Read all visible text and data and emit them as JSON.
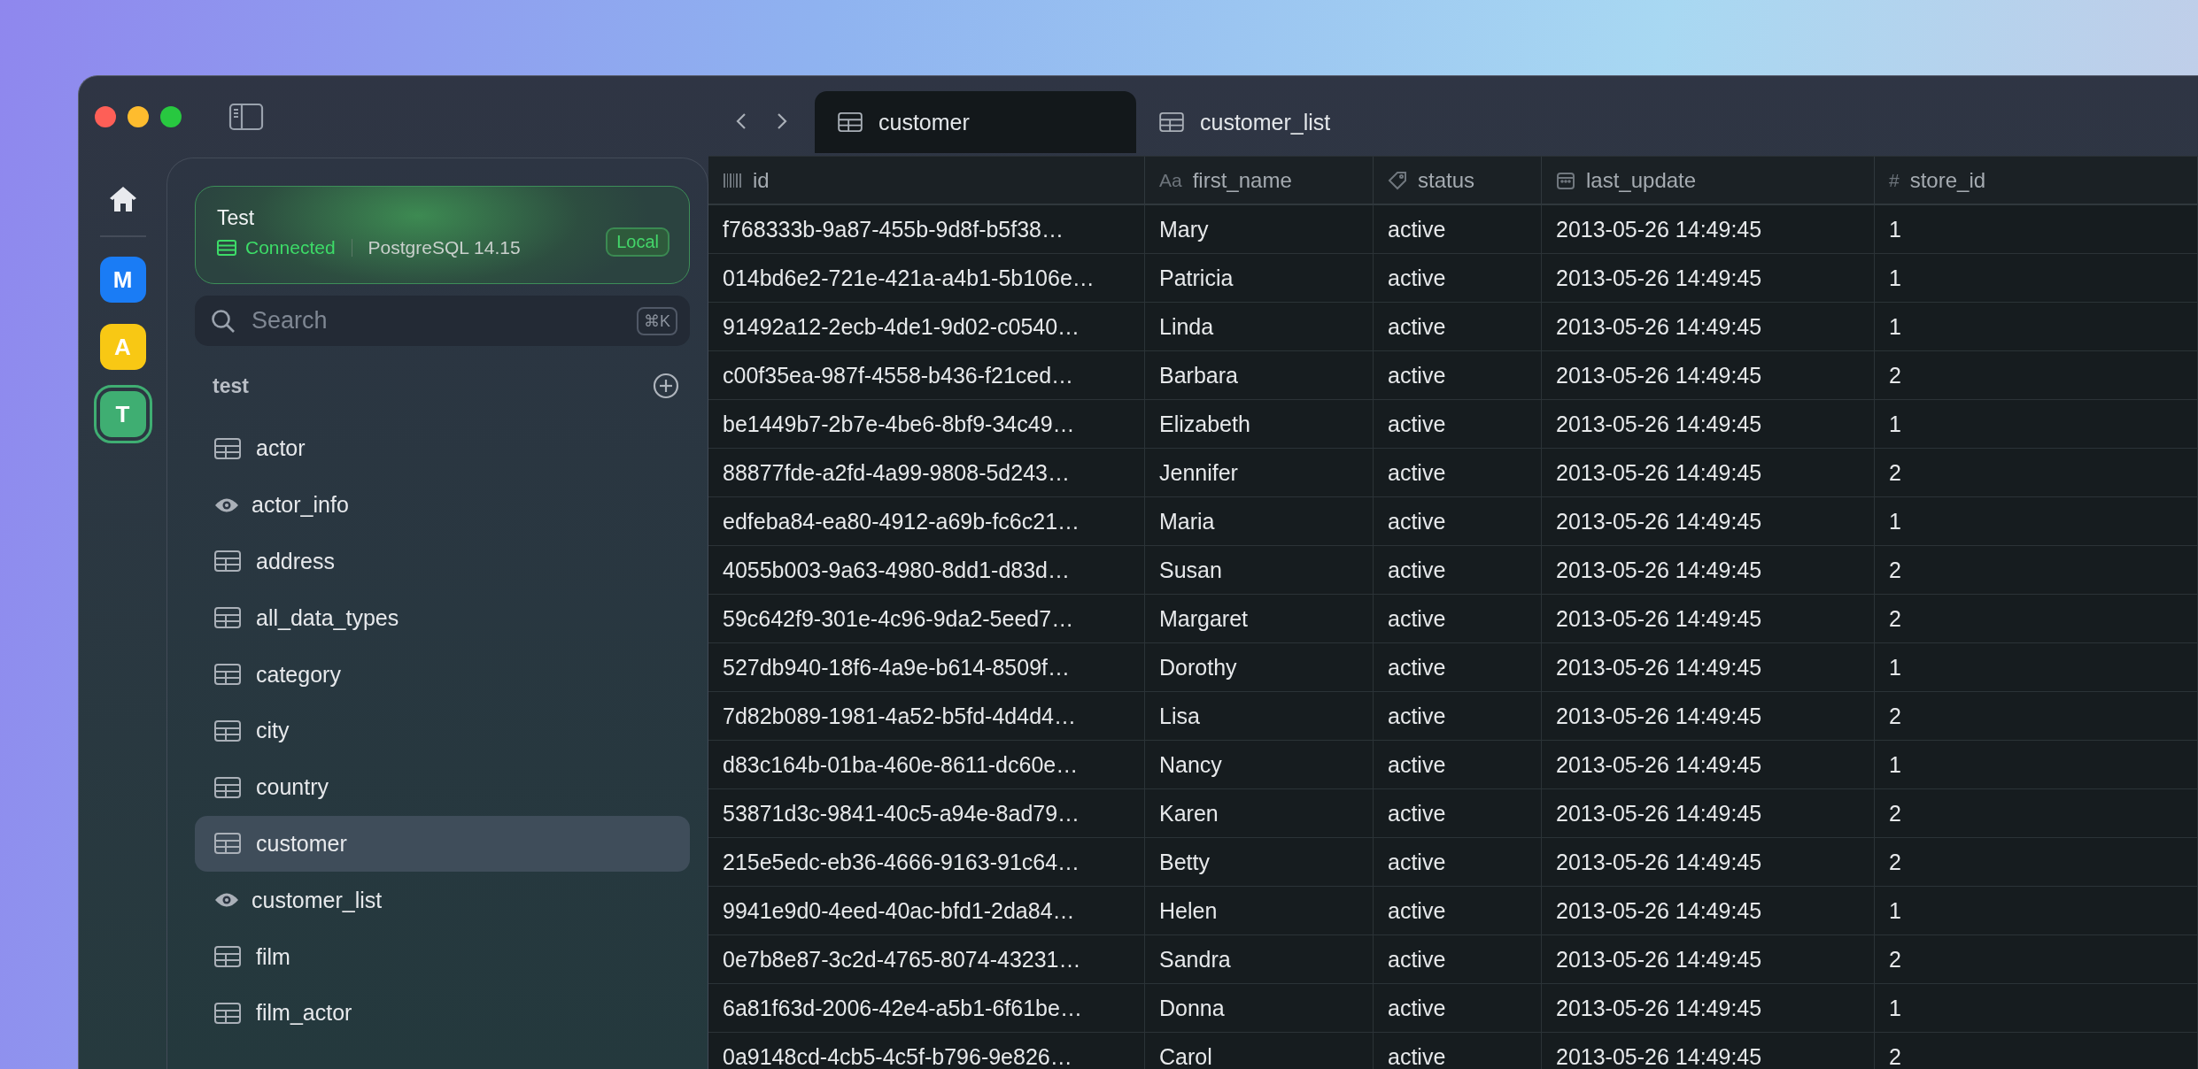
{
  "rail": {
    "connections": [
      {
        "letter": "M",
        "color": "#1a7cf5",
        "selected": false
      },
      {
        "letter": "A",
        "color": "#f8c814",
        "selected": false
      },
      {
        "letter": "T",
        "color": "#3fae72",
        "selected": true
      }
    ]
  },
  "connection": {
    "name": "Test",
    "status": "Connected",
    "engine": "PostgreSQL 14.15",
    "badge": "Local"
  },
  "search": {
    "placeholder": "Search",
    "shortcut": "⌘K"
  },
  "schema": {
    "name": "test"
  },
  "sidebar": {
    "items": [
      {
        "name": "actor",
        "kind": "table",
        "selected": false
      },
      {
        "name": "actor_info",
        "kind": "view",
        "selected": false
      },
      {
        "name": "address",
        "kind": "table",
        "selected": false
      },
      {
        "name": "all_data_types",
        "kind": "table",
        "selected": false
      },
      {
        "name": "category",
        "kind": "table",
        "selected": false
      },
      {
        "name": "city",
        "kind": "table",
        "selected": false
      },
      {
        "name": "country",
        "kind": "table",
        "selected": false
      },
      {
        "name": "customer",
        "kind": "table",
        "selected": true
      },
      {
        "name": "customer_list",
        "kind": "view",
        "selected": false
      },
      {
        "name": "film",
        "kind": "table",
        "selected": false
      },
      {
        "name": "film_actor",
        "kind": "table",
        "selected": false
      }
    ]
  },
  "tabs": [
    {
      "label": "customer",
      "selected": true
    },
    {
      "label": "customer_list",
      "selected": false
    }
  ],
  "table": {
    "columns": [
      {
        "name": "id",
        "kind": "uuid"
      },
      {
        "name": "first_name",
        "kind": "text",
        "glyph": "Aa"
      },
      {
        "name": "status",
        "kind": "tag"
      },
      {
        "name": "last_update",
        "kind": "date"
      },
      {
        "name": "store_id",
        "kind": "number",
        "glyph": "#"
      }
    ],
    "rows": [
      [
        "f768333b-9a87-455b-9d8f-b5f38…",
        "Mary",
        "active",
        "2013-05-26 14:49:45",
        "1"
      ],
      [
        "014bd6e2-721e-421a-a4b1-5b106e…",
        "Patricia",
        "active",
        "2013-05-26 14:49:45",
        "1"
      ],
      [
        "91492a12-2ecb-4de1-9d02-c0540…",
        "Linda",
        "active",
        "2013-05-26 14:49:45",
        "1"
      ],
      [
        "c00f35ea-987f-4558-b436-f21ced…",
        "Barbara",
        "active",
        "2013-05-26 14:49:45",
        "2"
      ],
      [
        "be1449b7-2b7e-4be6-8bf9-34c49…",
        "Elizabeth",
        "active",
        "2013-05-26 14:49:45",
        "1"
      ],
      [
        "88877fde-a2fd-4a99-9808-5d243…",
        "Jennifer",
        "active",
        "2013-05-26 14:49:45",
        "2"
      ],
      [
        "edfeba84-ea80-4912-a69b-fc6c21…",
        "Maria",
        "active",
        "2013-05-26 14:49:45",
        "1"
      ],
      [
        "4055b003-9a63-4980-8dd1-d83d…",
        "Susan",
        "active",
        "2013-05-26 14:49:45",
        "2"
      ],
      [
        "59c642f9-301e-4c96-9da2-5eed7…",
        "Margaret",
        "active",
        "2013-05-26 14:49:45",
        "2"
      ],
      [
        "527db940-18f6-4a9e-b614-8509f…",
        "Dorothy",
        "active",
        "2013-05-26 14:49:45",
        "1"
      ],
      [
        "7d82b089-1981-4a52-b5fd-4d4d4…",
        "Lisa",
        "active",
        "2013-05-26 14:49:45",
        "2"
      ],
      [
        "d83c164b-01ba-460e-8611-dc60e…",
        "Nancy",
        "active",
        "2013-05-26 14:49:45",
        "1"
      ],
      [
        "53871d3c-9841-40c5-a94e-8ad79…",
        "Karen",
        "active",
        "2013-05-26 14:49:45",
        "2"
      ],
      [
        "215e5edc-eb36-4666-9163-91c64…",
        "Betty",
        "active",
        "2013-05-26 14:49:45",
        "2"
      ],
      [
        "9941e9d0-4eed-40ac-bfd1-2da84…",
        "Helen",
        "active",
        "2013-05-26 14:49:45",
        "1"
      ],
      [
        "0e7b8e87-3c2d-4765-8074-43231…",
        "Sandra",
        "active",
        "2013-05-26 14:49:45",
        "2"
      ],
      [
        "6a81f63d-2006-42e4-a5b1-6f61be…",
        "Donna",
        "active",
        "2013-05-26 14:49:45",
        "1"
      ],
      [
        "0a9148cd-4cb5-4c5f-b796-9e826…",
        "Carol",
        "active",
        "2013-05-26 14:49:45",
        "2"
      ]
    ]
  }
}
